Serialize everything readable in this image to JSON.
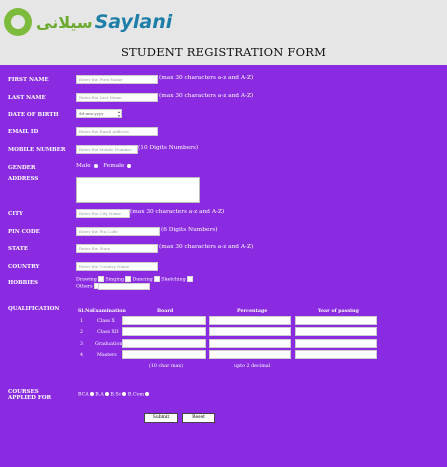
{
  "header": {
    "logo_urdu": "سیلانی",
    "logo_en": "Saylani",
    "title": "STUDENT REGISTRATION FORM"
  },
  "fields": {
    "first_name": {
      "label": "FIRST NAME",
      "placeholder": "Enter the First Name",
      "hint": "(max 30 characters a-z and A-Z)"
    },
    "last_name": {
      "label": "LAST NAME",
      "placeholder": "Enter the Last Name",
      "hint": "(max 30 characters a-z and A-Z)"
    },
    "dob": {
      "label": "DATE OF BIRTH",
      "value": "dd-mm-yyyy"
    },
    "email": {
      "label": "EMAIL ID",
      "placeholder": "Enter the Email Address"
    },
    "mobile": {
      "label": "MOBILE NUMBER",
      "placeholder": "Enter the Mobile Number",
      "hint": "(10 Digits Numbers)"
    },
    "gender": {
      "label": "GENDER",
      "male": "Male",
      "female": "Female"
    },
    "address": {
      "label": "ADDRESS"
    },
    "city": {
      "label": "CITY",
      "placeholder": "Enter the City Name",
      "hint": "(max 30 characters a-z and A-Z)"
    },
    "pin": {
      "label": "PIN CODE",
      "placeholder": "Enter the Pin Code",
      "hint": "(6 Digits Numbers)"
    },
    "state": {
      "label": "STATE",
      "placeholder": "Enter the State",
      "hint": "(max 30 characters a-z and A-Z)"
    },
    "country": {
      "label": "COUNTRY",
      "placeholder": "Enter the Country Name"
    },
    "hobbies": {
      "label": "HOBBIES",
      "items": [
        "Drawing",
        "Singing",
        "Dancing",
        "Sketching"
      ],
      "others": "Others"
    }
  },
  "qualification": {
    "label": "QUALIFICATION",
    "headers": [
      "Sl.No",
      "Examination",
      "Board",
      "Percentage",
      "Year of passing"
    ],
    "rows": [
      {
        "no": "1",
        "exam": "Class X"
      },
      {
        "no": "2",
        "exam": "Class XII"
      },
      {
        "no": "3",
        "exam": "Graduation"
      },
      {
        "no": "4",
        "exam": "Masters"
      }
    ],
    "note_board": "(10 char max)",
    "note_percent": "upto 2 decimal"
  },
  "courses": {
    "label_line1": "COURSES",
    "label_line2": "APPLIED FOR",
    "options": [
      "BCA",
      "B.A",
      "B.Sc",
      "B.Com"
    ]
  },
  "buttons": {
    "submit": "Submit",
    "reset": "Reset"
  },
  "colors": {
    "form_bg": "#8a2be2",
    "header_bg": "#e6e6e6",
    "logo_green": "#6cab2f",
    "logo_blue": "#1d7ea8"
  }
}
